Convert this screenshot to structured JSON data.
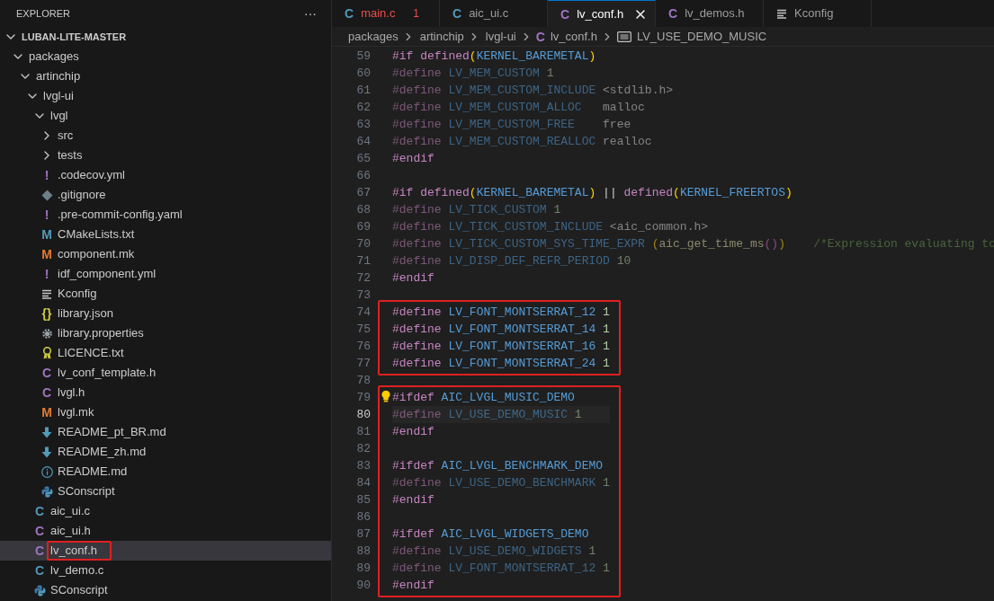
{
  "sidebar": {
    "title": "EXPLORER",
    "more": "···",
    "tree": [
      {
        "label": "LUBAN-LITE-MASTER",
        "kind": "folder",
        "expanded": true,
        "selected": false,
        "children": [
          {
            "label": "packages",
            "kind": "folder",
            "expanded": true,
            "selected": false,
            "children": [
              {
                "label": "artinchip",
                "kind": "folder",
                "expanded": true,
                "selected": false,
                "children": [
                  {
                    "label": "lvgl-ui",
                    "kind": "folder",
                    "expanded": true,
                    "selected": false,
                    "children": [
                      {
                        "label": "lvgl",
                        "kind": "folder",
                        "expanded": true,
                        "selected": false,
                        "children": [
                          {
                            "label": "src",
                            "kind": "folder",
                            "expanded": false,
                            "selected": false
                          },
                          {
                            "label": "tests",
                            "kind": "folder",
                            "expanded": false,
                            "selected": false
                          },
                          {
                            "label": ".codecov.yml",
                            "kind": "file",
                            "glyph": "!",
                            "color": "#a074c4",
                            "selected": false
                          },
                          {
                            "label": ".gitignore",
                            "kind": "git",
                            "selected": false
                          },
                          {
                            "label": ".pre-commit-config.yaml",
                            "kind": "file",
                            "glyph": "!",
                            "color": "#a074c4",
                            "selected": false
                          },
                          {
                            "label": "CMakeLists.txt",
                            "kind": "file",
                            "glyph": "M",
                            "color": "#519aba",
                            "selected": false
                          },
                          {
                            "label": "component.mk",
                            "kind": "file",
                            "glyph": "M",
                            "color": "#e37933",
                            "selected": false
                          },
                          {
                            "label": "idf_component.yml",
                            "kind": "file",
                            "glyph": "!",
                            "color": "#a074c4",
                            "selected": false
                          },
                          {
                            "label": "Kconfig",
                            "kind": "config",
                            "selected": false
                          },
                          {
                            "label": "library.json",
                            "kind": "file",
                            "glyph": "{}",
                            "color": "#cbcb41",
                            "selected": false
                          },
                          {
                            "label": "library.properties",
                            "kind": "settings",
                            "selected": false
                          },
                          {
                            "label": "LICENCE.txt",
                            "kind": "license",
                            "selected": false
                          },
                          {
                            "label": "lv_conf_template.h",
                            "kind": "file",
                            "glyph": "C",
                            "color": "#a074c4",
                            "selected": false
                          },
                          {
                            "label": "lvgl.h",
                            "kind": "file",
                            "glyph": "C",
                            "color": "#a074c4",
                            "selected": false
                          },
                          {
                            "label": "lvgl.mk",
                            "kind": "file",
                            "glyph": "M",
                            "color": "#e37933",
                            "selected": false
                          },
                          {
                            "label": "README_pt_BR.md",
                            "kind": "readme",
                            "selected": false
                          },
                          {
                            "label": "README_zh.md",
                            "kind": "readme",
                            "selected": false
                          },
                          {
                            "label": "README.md",
                            "kind": "info",
                            "selected": false
                          },
                          {
                            "label": "SConscript",
                            "kind": "python",
                            "selected": false
                          }
                        ]
                      },
                      {
                        "label": "aic_ui.c",
                        "kind": "file",
                        "glyph": "C",
                        "color": "#519aba",
                        "selected": false
                      },
                      {
                        "label": "aic_ui.h",
                        "kind": "file",
                        "glyph": "C",
                        "color": "#a074c4",
                        "selected": false
                      },
                      {
                        "label": "lv_conf.h",
                        "kind": "file",
                        "glyph": "C",
                        "color": "#a074c4",
                        "selected": true,
                        "outlined": true
                      },
                      {
                        "label": "lv_demo.c",
                        "kind": "file",
                        "glyph": "C",
                        "color": "#519aba",
                        "selected": false
                      },
                      {
                        "label": "SConscript",
                        "kind": "python",
                        "selected": false
                      }
                    ]
                  }
                ]
              }
            ]
          }
        ]
      }
    ]
  },
  "tabs": [
    {
      "label": "main.c",
      "kind": "file",
      "glyph": "C",
      "color": "#519aba",
      "error": true,
      "badge": "1",
      "selected": false
    },
    {
      "label": "aic_ui.c",
      "kind": "file",
      "glyph": "C",
      "color": "#519aba",
      "error": false,
      "selected": false
    },
    {
      "label": "lv_conf.h",
      "kind": "file",
      "glyph": "C",
      "color": "#a074c4",
      "error": false,
      "selected": true
    },
    {
      "label": "lv_demos.h",
      "kind": "file",
      "glyph": "C",
      "color": "#a074c4",
      "error": false,
      "selected": false
    },
    {
      "label": "Kconfig",
      "kind": "config",
      "error": false,
      "selected": false
    }
  ],
  "breadcrumb": [
    {
      "kind": "folder",
      "label": "packages"
    },
    {
      "kind": "folder",
      "label": "artinchip"
    },
    {
      "kind": "folder",
      "label": "lvgl-ui"
    },
    {
      "kind": "file",
      "glyph": "C",
      "label": "lv_conf.h"
    },
    {
      "kind": "symbol",
      "label": "LV_USE_DEMO_MUSIC"
    }
  ],
  "code": [
    {
      "lines": [
        {
          "n": "59",
          "inactive": false,
          "current": false,
          "tokens": [
            {
              "kind": "kw",
              "text": "#if "
            },
            {
              "kind": "kw",
              "text": "defined"
            },
            {
              "kind": "paren",
              "text": "("
            },
            {
              "kind": "macro",
              "text": "KERNEL_BAREMETAL"
            },
            {
              "kind": "paren",
              "text": ")"
            }
          ]
        },
        {
          "n": "60",
          "inactive": true,
          "current": false,
          "tokens": [
            {
              "kind": "kw",
              "text": "#define "
            },
            {
              "kind": "macro",
              "text": "LV_MEM_CUSTOM "
            },
            {
              "kind": "num",
              "text": "1"
            }
          ]
        },
        {
          "n": "61",
          "inactive": true,
          "current": false,
          "tokens": [
            {
              "kind": "kw",
              "text": "#define "
            },
            {
              "kind": "macro",
              "text": "LV_MEM_CUSTOM_INCLUDE "
            },
            {
              "kind": "plain",
              "text": "<stdlib.h>"
            }
          ]
        },
        {
          "n": "62",
          "inactive": true,
          "current": false,
          "tokens": [
            {
              "kind": "kw",
              "text": "#define "
            },
            {
              "kind": "macro",
              "text": "LV_MEM_CUSTOM_ALLOC   "
            },
            {
              "kind": "plain",
              "text": "malloc"
            }
          ]
        },
        {
          "n": "63",
          "inactive": true,
          "current": false,
          "tokens": [
            {
              "kind": "kw",
              "text": "#define "
            },
            {
              "kind": "macro",
              "text": "LV_MEM_CUSTOM_FREE    "
            },
            {
              "kind": "plain",
              "text": "free"
            }
          ]
        },
        {
          "n": "64",
          "inactive": true,
          "current": false,
          "tokens": [
            {
              "kind": "kw",
              "text": "#define "
            },
            {
              "kind": "macro",
              "text": "LV_MEM_CUSTOM_REALLOC "
            },
            {
              "kind": "plain",
              "text": "realloc"
            }
          ]
        },
        {
          "n": "65",
          "inactive": false,
          "current": false,
          "tokens": [
            {
              "kind": "kw",
              "text": "#endif"
            }
          ]
        },
        {
          "n": "66",
          "current": false
        },
        {
          "n": "67",
          "inactive": false,
          "current": false,
          "tokens": [
            {
              "kind": "kw",
              "text": "#if "
            },
            {
              "kind": "kw",
              "text": "defined"
            },
            {
              "kind": "paren",
              "text": "("
            },
            {
              "kind": "macro",
              "text": "KERNEL_BAREMETAL"
            },
            {
              "kind": "paren",
              "text": ")"
            },
            {
              "kind": "plain",
              "text": " || "
            },
            {
              "kind": "kw",
              "text": "defined"
            },
            {
              "kind": "paren",
              "text": "("
            },
            {
              "kind": "macro",
              "text": "KERNEL_FREERTOS"
            },
            {
              "kind": "paren",
              "text": ")"
            }
          ]
        },
        {
          "n": "68",
          "inactive": true,
          "current": false,
          "tokens": [
            {
              "kind": "kw",
              "text": "#define "
            },
            {
              "kind": "macro",
              "text": "LV_TICK_CUSTOM "
            },
            {
              "kind": "num",
              "text": "1"
            }
          ]
        },
        {
          "n": "69",
          "inactive": true,
          "current": false,
          "tokens": [
            {
              "kind": "kw",
              "text": "#define "
            },
            {
              "kind": "macro",
              "text": "LV_TICK_CUSTOM_INCLUDE "
            },
            {
              "kind": "plain",
              "text": "<aic_common.h>"
            }
          ]
        },
        {
          "n": "70",
          "inactive": true,
          "current": false,
          "tokens": [
            {
              "kind": "kw",
              "text": "#define "
            },
            {
              "kind": "macro",
              "text": "LV_TICK_CUSTOM_SYS_TIME_EXPR "
            },
            {
              "kind": "paren",
              "text": "("
            },
            {
              "kind": "fn",
              "text": "aic_get_time_ms"
            },
            {
              "kind": "paren2",
              "text": "()"
            },
            {
              "kind": "paren",
              "text": ")"
            },
            {
              "kind": "comment",
              "text": "    /*Expression evaluating to"
            }
          ]
        },
        {
          "n": "71",
          "inactive": true,
          "current": false,
          "tokens": [
            {
              "kind": "kw",
              "text": "#define "
            },
            {
              "kind": "macro",
              "text": "LV_DISP_DEF_REFR_PERIOD "
            },
            {
              "kind": "num",
              "text": "10"
            }
          ]
        },
        {
          "n": "72",
          "inactive": false,
          "current": false,
          "tokens": [
            {
              "kind": "kw",
              "text": "#endif"
            }
          ]
        },
        {
          "n": "73",
          "current": false
        }
      ]
    },
    {
      "outlined": true,
      "lines": [
        {
          "n": "74",
          "inactive": false,
          "current": false,
          "tokens": [
            {
              "kind": "kw",
              "text": "#define "
            },
            {
              "kind": "macro",
              "text": "LV_FONT_MONTSERRAT_12 "
            },
            {
              "kind": "num",
              "text": "1"
            }
          ]
        },
        {
          "n": "75",
          "inactive": false,
          "current": false,
          "tokens": [
            {
              "kind": "kw",
              "text": "#define "
            },
            {
              "kind": "macro",
              "text": "LV_FONT_MONTSERRAT_14 "
            },
            {
              "kind": "num",
              "text": "1"
            }
          ]
        },
        {
          "n": "76",
          "inactive": false,
          "current": false,
          "tokens": [
            {
              "kind": "kw",
              "text": "#define "
            },
            {
              "kind": "macro",
              "text": "LV_FONT_MONTSERRAT_16 "
            },
            {
              "kind": "num",
              "text": "1"
            }
          ]
        },
        {
          "n": "77",
          "inactive": false,
          "current": false,
          "tokens": [
            {
              "kind": "kw",
              "text": "#define "
            },
            {
              "kind": "macro",
              "text": "LV_FONT_MONTSERRAT_24 "
            },
            {
              "kind": "num",
              "text": "1"
            }
          ]
        }
      ]
    },
    {
      "lines": [
        {
          "n": "78",
          "current": false
        }
      ]
    },
    {
      "outlined": true,
      "lines": [
        {
          "n": "79",
          "inactive": false,
          "current": false,
          "lightbulb": true,
          "tokens": [
            {
              "kind": "kw",
              "text": "#ifdef "
            },
            {
              "kind": "macro",
              "text": "AIC_LVGL_MUSIC_DEMO"
            }
          ]
        },
        {
          "n": "80",
          "inactive": true,
          "current": true,
          "tokens": [
            {
              "kind": "kw",
              "text": "#define "
            },
            {
              "kind": "macro",
              "text": "LV_USE_DEMO_MUSIC "
            },
            {
              "kind": "num",
              "text": "1"
            }
          ]
        },
        {
          "n": "81",
          "inactive": false,
          "current": false,
          "tokens": [
            {
              "kind": "kw",
              "text": "#endif"
            }
          ]
        },
        {
          "n": "82",
          "current": false
        },
        {
          "n": "83",
          "inactive": false,
          "current": false,
          "tokens": [
            {
              "kind": "kw",
              "text": "#ifdef "
            },
            {
              "kind": "macro",
              "text": "AIC_LVGL_BENCHMARK_DEMO"
            }
          ]
        },
        {
          "n": "84",
          "inactive": true,
          "current": false,
          "tokens": [
            {
              "kind": "kw",
              "text": "#define "
            },
            {
              "kind": "macro",
              "text": "LV_USE_DEMO_BENCHMARK "
            },
            {
              "kind": "num",
              "text": "1"
            }
          ]
        },
        {
          "n": "85",
          "inactive": false,
          "current": false,
          "tokens": [
            {
              "kind": "kw",
              "text": "#endif"
            }
          ]
        },
        {
          "n": "86",
          "current": false
        },
        {
          "n": "87",
          "inactive": false,
          "current": false,
          "tokens": [
            {
              "kind": "kw",
              "text": "#ifdef "
            },
            {
              "kind": "macro",
              "text": "AIC_LVGL_WIDGETS_DEMO"
            }
          ]
        },
        {
          "n": "88",
          "inactive": true,
          "current": false,
          "tokens": [
            {
              "kind": "kw",
              "text": "#define "
            },
            {
              "kind": "macro",
              "text": "LV_USE_DEMO_WIDGETS "
            },
            {
              "kind": "num",
              "text": "1"
            }
          ]
        },
        {
          "n": "89",
          "inactive": true,
          "current": false,
          "tokens": [
            {
              "kind": "kw",
              "text": "#define "
            },
            {
              "kind": "macro",
              "text": "LV_FONT_MONTSERRAT_12 "
            },
            {
              "kind": "num",
              "text": "1"
            }
          ]
        },
        {
          "n": "90",
          "inactive": false,
          "current": false,
          "tokens": [
            {
              "kind": "kw",
              "text": "#endif"
            }
          ]
        }
      ]
    }
  ]
}
